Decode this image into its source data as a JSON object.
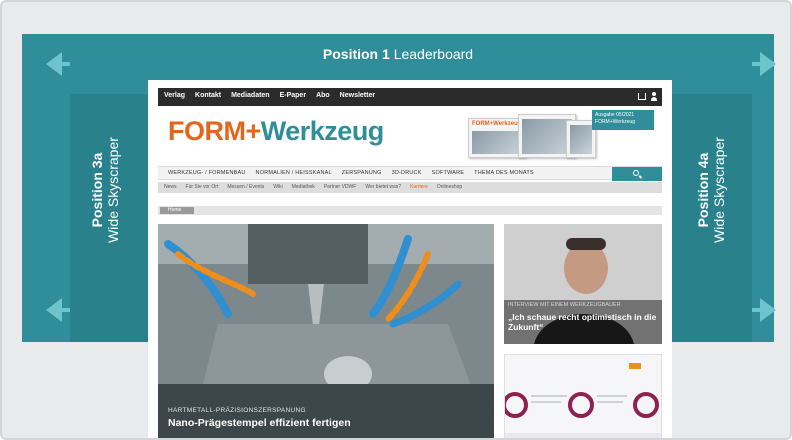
{
  "leaderboard": {
    "position": "Position 1",
    "label": "Leaderboard"
  },
  "sky_left": {
    "position": "Position 3a",
    "label": "Wide Skyscraper"
  },
  "sky_right": {
    "position": "Position 4a",
    "label": "Wide Skyscraper"
  },
  "colors": {
    "ad_teal": "#2f8e99",
    "ad_teal_dark": "#29818b",
    "arrow": "#6ec4cc",
    "brand_orange": "#e2661b",
    "frame_bg": "#e8eaec"
  },
  "site": {
    "topbar_items": [
      "Verlag",
      "Kontakt",
      "Mediadaten",
      "E-Paper",
      "Abo",
      "Newsletter"
    ],
    "logo": {
      "part1": "FORM",
      "plus": "+",
      "part2": "Werkzeug"
    },
    "issue_badge": "Ausgabe 05/2021 FORM+Werkzeug",
    "magazine_title": "FORM+Werkzeug",
    "main_nav": [
      "WERKZEUG- / FORMENBAU",
      "NORMALIEN / HEISSKANAL",
      "ZERSPANUNG",
      "3D-DRUCK",
      "SOFTWARE",
      "THEMA DES MONATS"
    ],
    "sub_nav": [
      "News",
      "Für Sie vor Ort",
      "Messen / Events",
      "Wiki",
      "Mediathek",
      "Partner VDWF",
      "Wer bietet was?",
      "Karriere",
      "Onlineshop"
    ],
    "breadcrumb": "Home",
    "hero": {
      "kicker": "HARTMETALL-PRÄZISIONSZERSPANUNG",
      "title": "Nano-Prägestempel effizient fertigen"
    },
    "side": {
      "kicker": "INTERVIEW MIT EINEM WERKZEUGBAUER",
      "title": "„Ich schaue recht optimistisch in die Zukunft“"
    }
  }
}
